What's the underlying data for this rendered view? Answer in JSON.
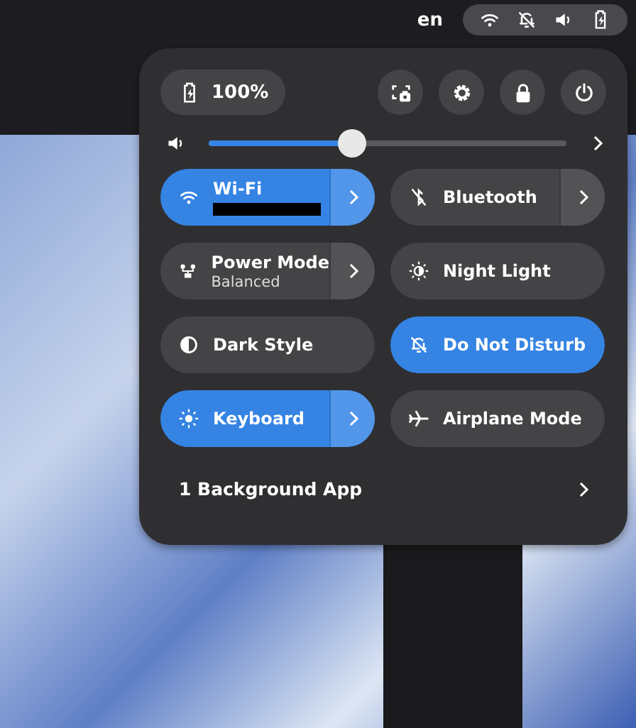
{
  "top_bar": {
    "language": "en"
  },
  "quick_settings": {
    "battery": {
      "label": "100%"
    },
    "volume": {
      "level": 0.4
    },
    "toggles": [
      {
        "kind": "wifi",
        "label": "Wi-Fi",
        "redacted_subtitle": true,
        "on": true,
        "has_menu": true
      },
      {
        "kind": "bluetooth",
        "label": "Bluetooth",
        "on": false,
        "has_menu": true
      },
      {
        "kind": "power",
        "label": "Power Mode",
        "subtitle": "Balanced",
        "on": false,
        "has_menu": true
      },
      {
        "kind": "night",
        "label": "Night Light",
        "on": false,
        "has_menu": false
      },
      {
        "kind": "dark",
        "label": "Dark Style",
        "on": false,
        "has_menu": false
      },
      {
        "kind": "dnd",
        "label": "Do Not Disturb",
        "on": true,
        "has_menu": false
      },
      {
        "kind": "keyboard",
        "label": "Keyboard",
        "on": true,
        "has_menu": true
      },
      {
        "kind": "airplane",
        "label": "Airplane Mode",
        "on": false,
        "has_menu": false
      }
    ],
    "background_apps": {
      "label": "1 Background App"
    }
  }
}
